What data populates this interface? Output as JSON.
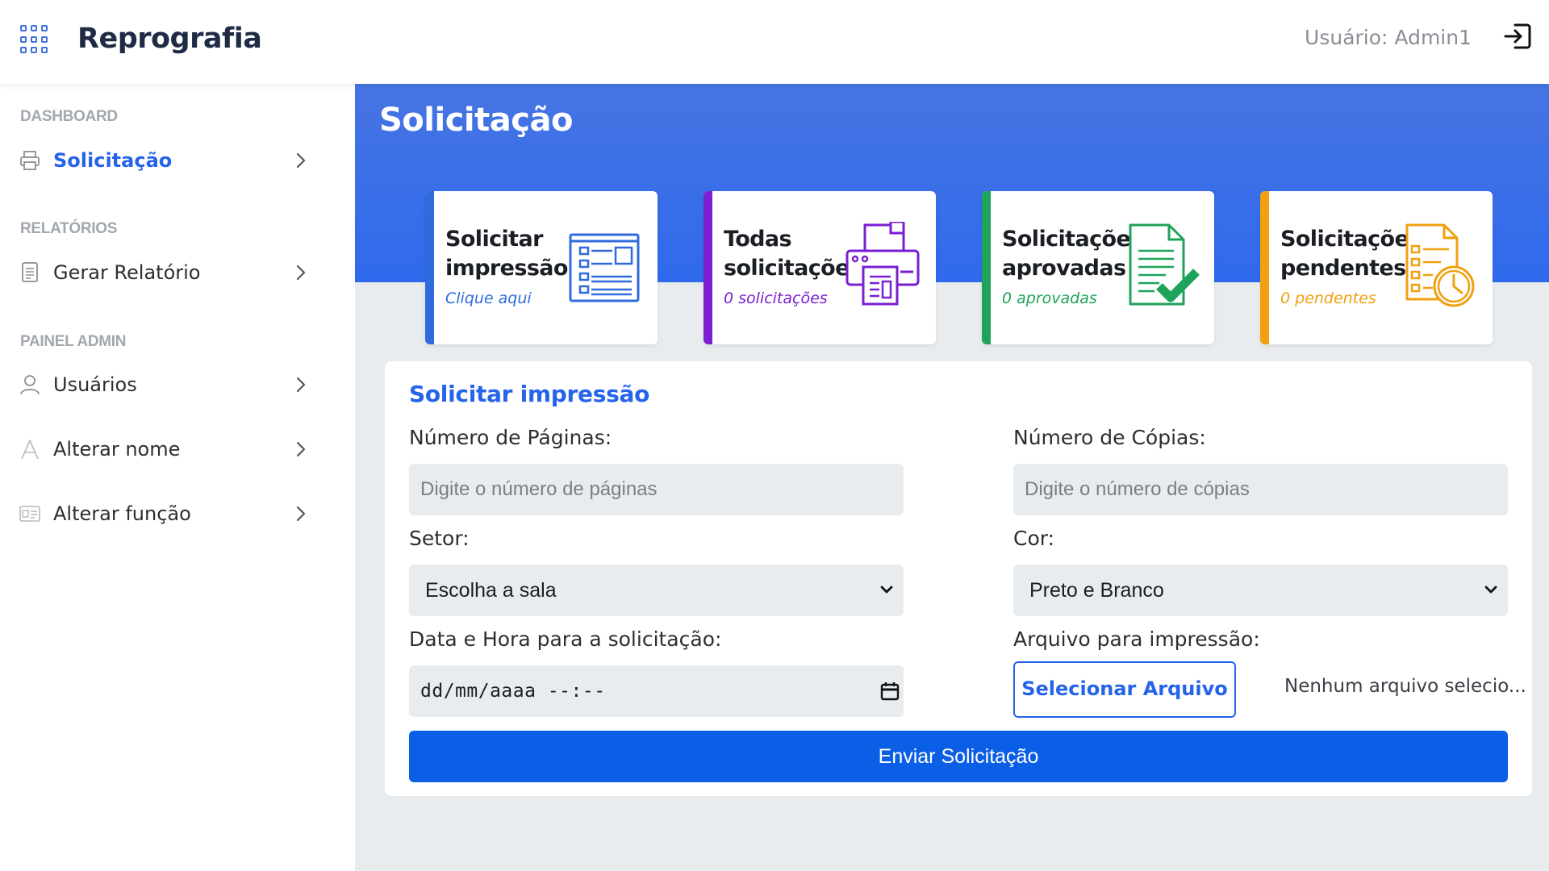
{
  "app": {
    "title": "Reprografia",
    "user_label": "Usuário: Admin1"
  },
  "sidebar": {
    "sections": [
      {
        "label": "DASHBOARD"
      },
      {
        "label": "RELATÓRIOS"
      },
      {
        "label": "PAINEL ADMIN"
      }
    ],
    "items": [
      {
        "label": "Solicitação",
        "icon": "printer-icon",
        "active": true
      },
      {
        "label": "Gerar Relatório",
        "icon": "document-icon",
        "active": false
      },
      {
        "label": "Usuários",
        "icon": "user-icon",
        "active": false
      },
      {
        "label": "Alterar nome",
        "icon": "letter-a-icon",
        "active": false
      },
      {
        "label": "Alterar função",
        "icon": "id-card-icon",
        "active": false
      }
    ]
  },
  "page": {
    "title": "Solicitação"
  },
  "cards": [
    {
      "title": "Solicitar impressão",
      "subtitle": "Clique aqui",
      "color": "#2f6bdc",
      "icon": "form-list-icon"
    },
    {
      "title": "Todas solicitações",
      "subtitle": "0 solicitações",
      "color": "#7a1fd1",
      "icon": "printer-icon"
    },
    {
      "title": "Solicitações aprovadas",
      "subtitle": "0 aprovadas",
      "color": "#1ea35a",
      "icon": "document-check-icon"
    },
    {
      "title": "Solicitações pendentes",
      "subtitle": "0 pendentes",
      "color": "#f0a010",
      "icon": "document-clock-icon"
    }
  ],
  "form": {
    "title": "Solicitar impressão",
    "pages_label": "Número de Páginas:",
    "pages_placeholder": "Digite o número de páginas",
    "copies_label": "Número de Cópias:",
    "copies_placeholder": "Digite o número de cópias",
    "sector_label": "Setor:",
    "sector_selected": "Escolha a sala",
    "color_label": "Cor:",
    "color_selected": "Preto e Branco",
    "datetime_label": "Data e Hora para a solicitação:",
    "datetime_placeholder": "dd/mm/aaaa --:--",
    "file_label": "Arquivo para impressão:",
    "file_button": "Selecionar Arquivo",
    "file_status": "Nenhum arquivo selecio...",
    "submit_label": "Enviar Solicitação"
  },
  "colors": {
    "accent": "#2563eb",
    "header": "#2f6aed",
    "submit": "#0b5ee6"
  }
}
